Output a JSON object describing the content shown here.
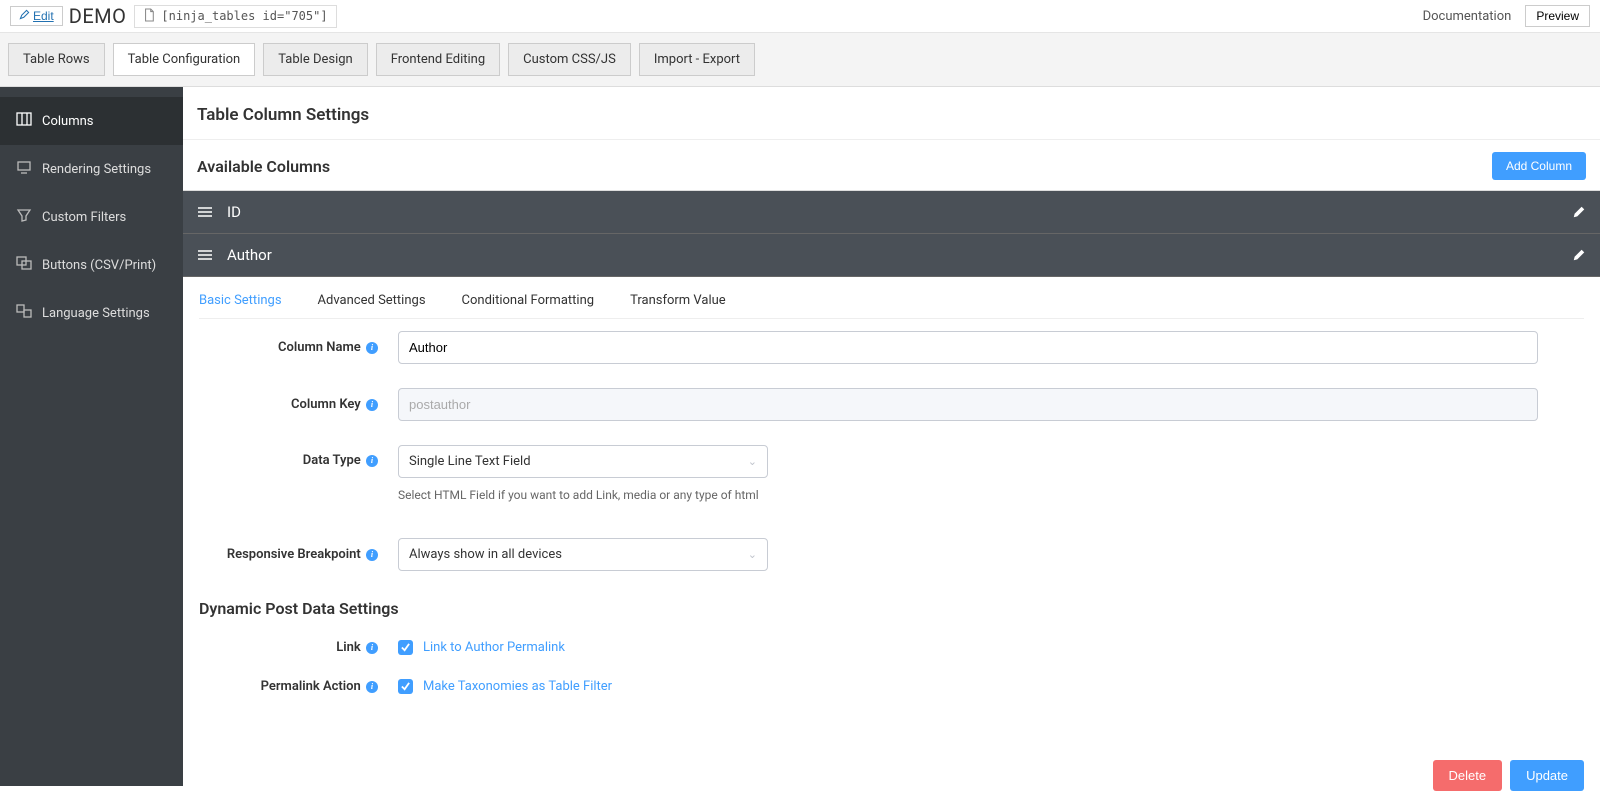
{
  "topbar": {
    "edit_label": "Edit",
    "title": "DEMO",
    "shortcode": "[ninja_tables id=\"705\"]",
    "documentation": "Documentation",
    "preview": "Preview"
  },
  "main_tabs": [
    {
      "label": "Table Rows",
      "active": false
    },
    {
      "label": "Table Configuration",
      "active": true
    },
    {
      "label": "Table Design",
      "active": false
    },
    {
      "label": "Frontend Editing",
      "active": false
    },
    {
      "label": "Custom CSS/JS",
      "active": false
    },
    {
      "label": "Import - Export",
      "active": false
    }
  ],
  "sidebar": [
    {
      "label": "Columns",
      "icon": "columns",
      "active": true
    },
    {
      "label": "Rendering Settings",
      "icon": "render",
      "active": false
    },
    {
      "label": "Custom Filters",
      "icon": "filter",
      "active": false
    },
    {
      "label": "Buttons (CSV/Print)",
      "icon": "buttons",
      "active": false
    },
    {
      "label": "Language Settings",
      "icon": "language",
      "active": false
    }
  ],
  "page": {
    "section_title": "Table Column Settings",
    "available_columns_title": "Available Columns",
    "add_column_label": "Add Column"
  },
  "columns": [
    {
      "name": "ID"
    },
    {
      "name": "Author"
    }
  ],
  "settings_tabs": [
    {
      "label": "Basic Settings",
      "active": true
    },
    {
      "label": "Advanced Settings",
      "active": false
    },
    {
      "label": "Conditional Formatting",
      "active": false
    },
    {
      "label": "Transform Value",
      "active": false
    }
  ],
  "form": {
    "column_name": {
      "label": "Column Name",
      "value": "Author"
    },
    "column_key": {
      "label": "Column Key",
      "value": "postauthor"
    },
    "data_type": {
      "label": "Data Type",
      "value": "Single Line Text Field",
      "help": "Select HTML Field if you want to add Link, media or any type of html"
    },
    "breakpoint": {
      "label": "Responsive Breakpoint",
      "value": "Always show in all devices"
    }
  },
  "dynamic": {
    "heading": "Dynamic Post Data Settings",
    "link": {
      "label": "Link",
      "checkbox_label": "Link to Author Permalink",
      "checked": true
    },
    "permalink": {
      "label": "Permalink Action",
      "checkbox_label": "Make Taxonomies as Table Filter",
      "checked": true
    }
  },
  "footer": {
    "delete": "Delete",
    "update": "Update"
  }
}
